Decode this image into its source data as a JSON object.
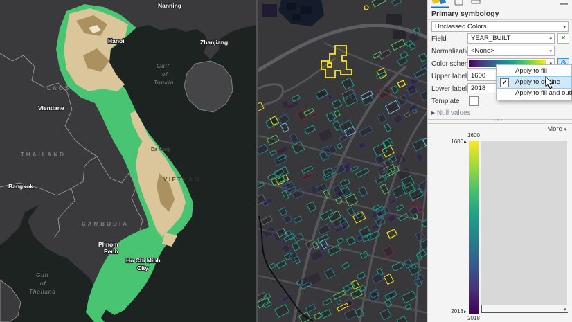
{
  "left_map": {
    "country_labels": {
      "laos": "LAOS",
      "thailand": "THAILAND",
      "cambodia": "CAMBODIA",
      "vietnam": "VIETNAM"
    },
    "city_labels": {
      "nanning": "Nanning",
      "hanoi": "Hanoi",
      "zhanjiang": "Zhanjiang",
      "vientiane": "Vientiane",
      "bangkok": "Bangkok",
      "da_nang": "Da Nang",
      "phnom_penh": [
        "Phnom",
        "Penh"
      ],
      "ho_chi_minh_city": [
        "Ho Chi Minh",
        "City"
      ]
    },
    "water_labels": {
      "gulf_of_tonkin": [
        "Gulf",
        "of",
        "Tonkin"
      ],
      "gulf_of_thailand": [
        "Gulf",
        "of",
        "Thailand"
      ]
    }
  },
  "symbology_panel": {
    "title": "Primary symbology",
    "method_value": "Unclassed Colors",
    "field_label": "Field",
    "field_value": "YEAR_BUILT",
    "normalization_label": "Normalization",
    "normalization_value": "<None>",
    "color_scheme_label": "Color scheme",
    "upper_label_label": "Upper label",
    "upper_label_value": "1600",
    "lower_label_label": "Lower label",
    "lower_label_value": "2018",
    "template_label": "Template",
    "null_values_label": "Null values",
    "more_label": "More",
    "histogram": {
      "upper_value": "1600",
      "lower_value": "2018",
      "upper_tick": "1600",
      "lower_tick": "2018"
    }
  },
  "context_menu": {
    "items": [
      {
        "label": "Apply to fill",
        "checked": false
      },
      {
        "label": "Apply to outline",
        "checked": true
      },
      {
        "label": "Apply to fill and outline",
        "checked": false
      }
    ]
  },
  "icons": {
    "checkmark": "✓",
    "dropdown_arrow": "▾",
    "collapsed_arrow": "▸",
    "left_arrow_tick": "►",
    "minimize": "—",
    "gear": "⚙",
    "remove_x": "×"
  },
  "colors": {
    "viridis": [
      "#440154",
      "#46327e",
      "#365c8d",
      "#277f8e",
      "#1fa187",
      "#4ac16d",
      "#a0da39",
      "#fde725"
    ],
    "panel_accent": "#0079c1",
    "menu_highlight": "#cfe9fb",
    "terrain_green": "#49c473",
    "terrain_tan": "#dbc69b",
    "building_palette": [
      {
        "c": "#1f9e89",
        "w": 38
      },
      {
        "c": "#26828e",
        "w": 16
      },
      {
        "c": "#52c569",
        "w": 8
      },
      {
        "c": "#3b568b",
        "w": 12
      },
      {
        "c": "#46307e",
        "w": 8
      },
      {
        "c": "#7fb2d9",
        "w": 3
      },
      {
        "c": "#f2e11f",
        "w": 3
      },
      {
        "c": "#8a2440",
        "w": 3
      },
      {
        "c": "#3f1d56",
        "w": 5
      },
      {
        "c": "#6a6a6e",
        "w": 2
      }
    ]
  }
}
